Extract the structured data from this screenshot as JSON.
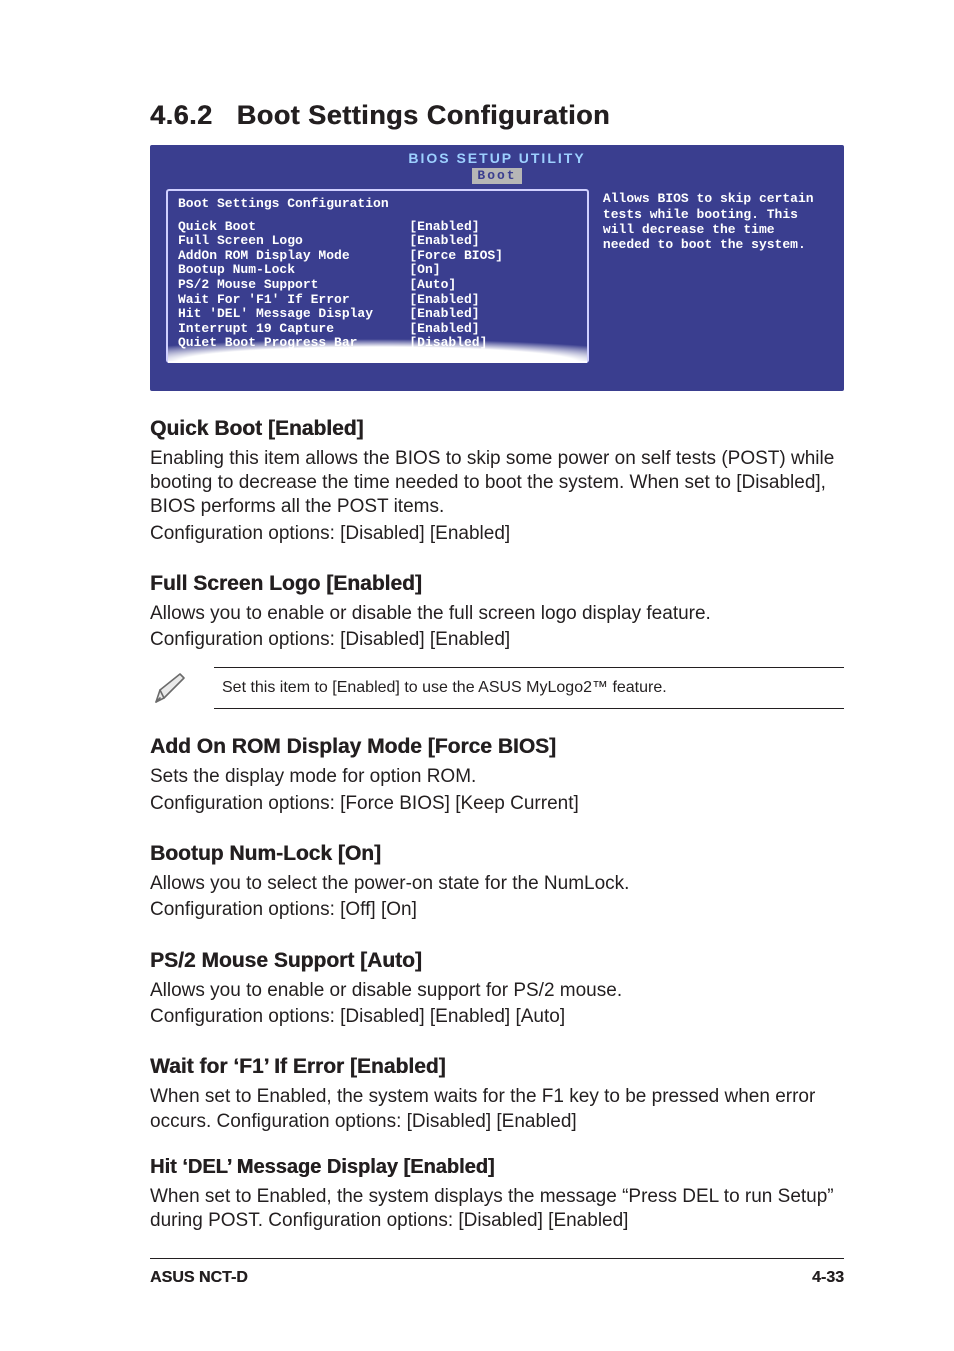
{
  "section": {
    "number": "4.6.2",
    "title": "Boot Settings Configuration"
  },
  "bios": {
    "header_line1": "BIOS SETUP UTILITY",
    "tab": "Boot",
    "panel_title": "Boot Settings Configuration",
    "rows": [
      {
        "label": "Quick Boot",
        "value": "[Enabled]"
      },
      {
        "label": "Full Screen Logo",
        "value": "[Enabled]"
      },
      {
        "label": "AddOn ROM Display Mode",
        "value": "[Force BIOS]"
      },
      {
        "label": "Bootup Num-Lock",
        "value": "[On]"
      },
      {
        "label": "PS/2 Mouse Support",
        "value": "[Auto]"
      },
      {
        "label": "Wait For 'F1' If Error",
        "value": "[Enabled]"
      },
      {
        "label": "Hit 'DEL' Message Display",
        "value": "[Enabled]"
      },
      {
        "label": "Interrupt 19 Capture",
        "value": "[Enabled]"
      },
      {
        "label": "Quiet Boot Progress Bar",
        "value": "[Disabled]"
      }
    ],
    "help_text": "Allows BIOS to skip certain tests while booting. This will decrease the time needed to boot the system."
  },
  "items": {
    "quick_boot": {
      "title": "Quick Boot [Enabled]",
      "body": "Enabling this item allows the BIOS to skip some power on self tests (POST) while booting to decrease the time needed to boot the system. When set to [Disabled], BIOS performs all the POST items.",
      "conf": "Configuration options: [Disabled] [Enabled]"
    },
    "full_screen_logo": {
      "title": "Full Screen Logo [Enabled]",
      "body": "Allows you to enable or disable the full screen logo display feature.",
      "conf": "Configuration options: [Disabled] [Enabled]"
    },
    "note": {
      "text": "Set this item to [Enabled] to use the ASUS MyLogo2™ feature."
    },
    "addon_rom": {
      "title": "Add On ROM Display Mode [Force BIOS]",
      "body": "Sets the display mode for option ROM.",
      "conf": "Configuration options: [Force BIOS] [Keep Current]"
    },
    "bootup_numlock": {
      "title": "Bootup Num-Lock [On]",
      "body": "Allows you to select the power-on state for the NumLock.",
      "conf": "Configuration options: [Off] [On]"
    },
    "ps2_mouse": {
      "title": "PS/2 Mouse Support [Auto]",
      "body": "Allows you to enable or disable support for PS/2 mouse.",
      "conf": "Configuration options: [Disabled] [Enabled] [Auto]"
    },
    "wait_f1": {
      "title": "Wait for ‘F1’ If Error [Enabled]",
      "body": "When set to Enabled, the system waits for the F1 key to be pressed when error occurs. Configuration options: [Disabled] [Enabled]"
    },
    "hit_del": {
      "title": "Hit ‘DEL’ Message Display [Enabled]",
      "body": "When set to Enabled, the system displays the message “Press DEL to run Setup” during POST. Configuration options: [Disabled] [Enabled]"
    }
  },
  "footer": {
    "left": "ASUS NCT-D",
    "right": "4-33"
  }
}
